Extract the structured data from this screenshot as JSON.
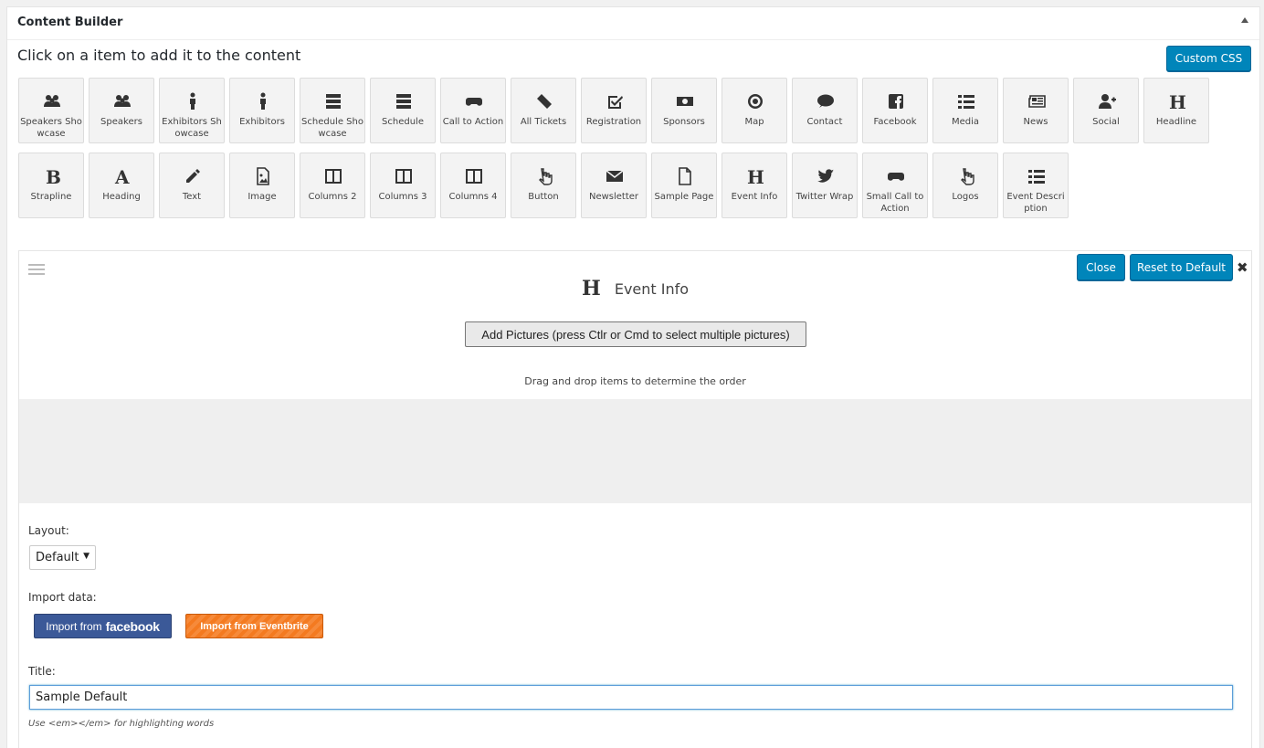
{
  "panel": {
    "title": "Content Builder"
  },
  "instruction": "Click on a item to add it to the content",
  "custom_css_label": "Custom CSS",
  "palette_items": [
    {
      "label": "Speakers Showcase",
      "icon": "users"
    },
    {
      "label": "Speakers",
      "icon": "users"
    },
    {
      "label": "Exhibitors Showcase",
      "icon": "person"
    },
    {
      "label": "Exhibitors",
      "icon": "person"
    },
    {
      "label": "Schedule Showcase",
      "icon": "server"
    },
    {
      "label": "Schedule",
      "icon": "server"
    },
    {
      "label": "Call to Action",
      "icon": "gamepad"
    },
    {
      "label": "All Tickets",
      "icon": "ticket"
    },
    {
      "label": "Registration",
      "icon": "checkbox"
    },
    {
      "label": "Sponsors",
      "icon": "money"
    },
    {
      "label": "Map",
      "icon": "target"
    },
    {
      "label": "Contact",
      "icon": "comment"
    },
    {
      "label": "Facebook",
      "icon": "facebook"
    },
    {
      "label": "Media",
      "icon": "list"
    },
    {
      "label": "News",
      "icon": "newspaper"
    },
    {
      "label": "Social",
      "icon": "user-plus"
    },
    {
      "label": "Headline",
      "icon": "letter-h"
    },
    {
      "label": "Strapline",
      "icon": "letter-b"
    },
    {
      "label": "Heading",
      "icon": "letter-a"
    },
    {
      "label": "Text",
      "icon": "pencil"
    },
    {
      "label": "Image",
      "icon": "image-file"
    },
    {
      "label": "Columns 2",
      "icon": "columns"
    },
    {
      "label": "Columns 3",
      "icon": "columns"
    },
    {
      "label": "Columns 4",
      "icon": "columns"
    },
    {
      "label": "Button",
      "icon": "hand-pointer"
    },
    {
      "label": "Newsletter",
      "icon": "envelope"
    },
    {
      "label": "Sample Page",
      "icon": "file"
    },
    {
      "label": "Event Info",
      "icon": "letter-h"
    },
    {
      "label": "Twitter Wrap",
      "icon": "twitter"
    },
    {
      "label": "Small Call to Action",
      "icon": "gamepad"
    },
    {
      "label": "Logos",
      "icon": "hand-pointer"
    },
    {
      "label": "Event Description",
      "icon": "list"
    }
  ],
  "editor": {
    "close_label": "Close",
    "reset_label": "Reset to Default",
    "remove_glyph": "✖",
    "block_icon_letter": "H",
    "block_title": "Event Info",
    "add_pictures_label": "Add Pictures (press Ctlr or Cmd to select multiple pictures)",
    "drag_hint": "Drag and drop items to determine the order",
    "layout_label": "Layout:",
    "layout_value": "Default",
    "import_label": "Import data:",
    "import_facebook_prefix": "Import from",
    "import_facebook_brand": "facebook",
    "import_eventbrite_label": "Import from Eventbrite",
    "title_label": "Title:",
    "title_value": "Sample Default",
    "title_help": "Use <em></em> for highlighting words"
  },
  "colors": {
    "primary": "#0085ba",
    "facebook": "#3b5998",
    "eventbrite": "#f47a20"
  }
}
